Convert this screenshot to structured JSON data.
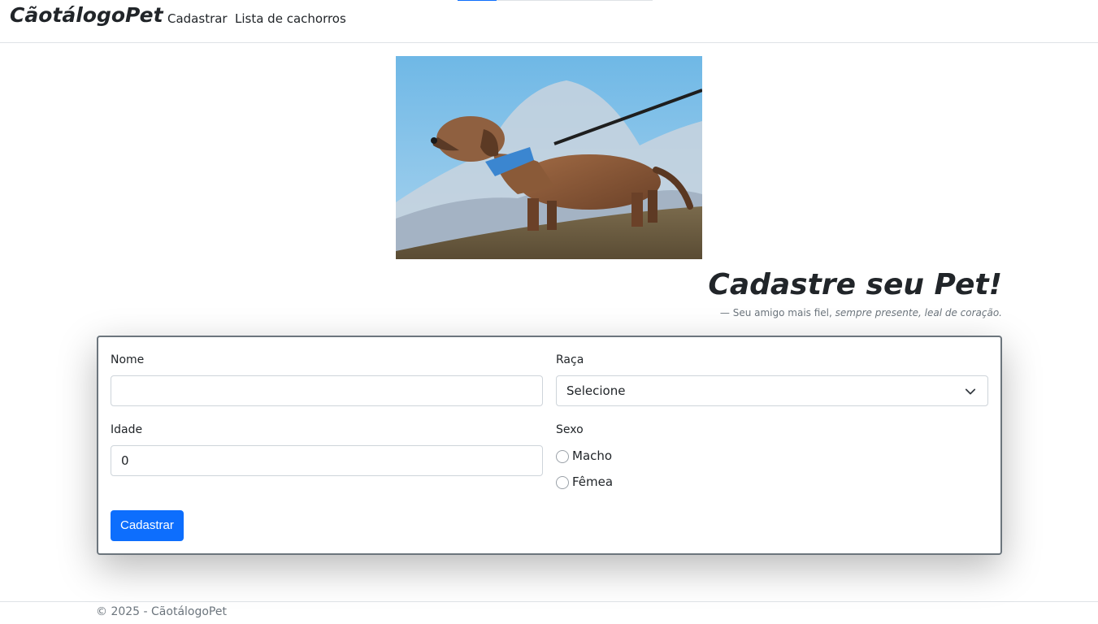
{
  "navbar": {
    "brand": "CãotálogoPet",
    "links": [
      "Cadastrar",
      "Lista de cachorros"
    ],
    "progress_fraction": 0.2
  },
  "hero": {
    "icon": "dog-photo"
  },
  "header": {
    "title": "Cadastre seu Pet!",
    "tagline_dash": "—",
    "tagline_plain": "Seu amigo mais fiel,",
    "tagline_italic": "sempre presente, leal de coração."
  },
  "form": {
    "nome_label": "Nome",
    "nome_value": "",
    "raca_label": "Raça",
    "raca_value": "Selecione",
    "idade_label": "Idade",
    "idade_value": "0",
    "sexo_label": "Sexo",
    "sexo_options": [
      "Macho",
      "Fêmea"
    ],
    "submit_label": "Cadastrar"
  },
  "footer": {
    "text": "© 2025 - CãotálogoPet"
  },
  "colors": {
    "primary": "#0d6efd",
    "muted": "#6c757d",
    "border": "#dee2e6"
  }
}
